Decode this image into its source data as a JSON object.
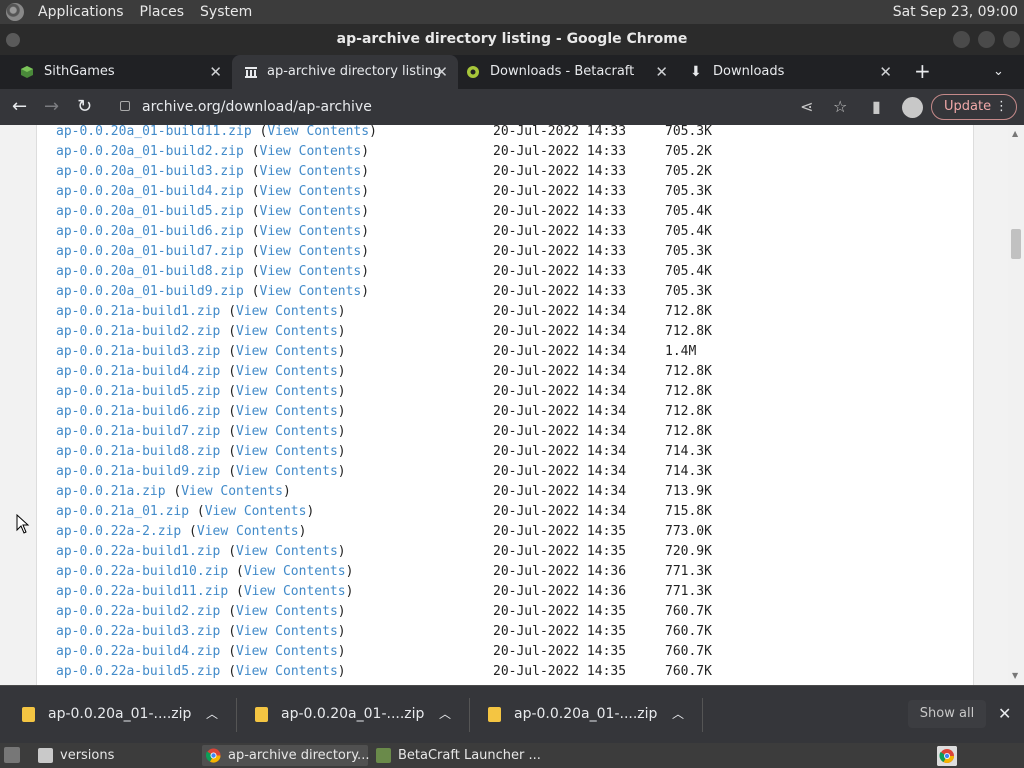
{
  "top_panel": {
    "menus": [
      "Applications",
      "Places",
      "System"
    ],
    "clock": "Sat Sep 23, 09:00"
  },
  "window": {
    "title": "ap-archive directory listing - Google Chrome"
  },
  "tabs": [
    {
      "label": "SithGames",
      "active": false
    },
    {
      "label": "ap-archive directory listing",
      "active": true
    },
    {
      "label": "Downloads - Betacraft",
      "active": false
    },
    {
      "label": "Downloads",
      "active": false
    }
  ],
  "toolbar": {
    "url": "archive.org/download/ap-archive",
    "update_label": "Update"
  },
  "listing": {
    "view_contents_label": "View Contents",
    "rows": [
      {
        "name": "ap-0.0.20a_01-build11.zip",
        "date": "20-Jul-2022 14:33",
        "size": "705.3K"
      },
      {
        "name": "ap-0.0.20a_01-build2.zip",
        "date": "20-Jul-2022 14:33",
        "size": "705.2K"
      },
      {
        "name": "ap-0.0.20a_01-build3.zip",
        "date": "20-Jul-2022 14:33",
        "size": "705.2K"
      },
      {
        "name": "ap-0.0.20a_01-build4.zip",
        "date": "20-Jul-2022 14:33",
        "size": "705.3K"
      },
      {
        "name": "ap-0.0.20a_01-build5.zip",
        "date": "20-Jul-2022 14:33",
        "size": "705.4K"
      },
      {
        "name": "ap-0.0.20a_01-build6.zip",
        "date": "20-Jul-2022 14:33",
        "size": "705.4K"
      },
      {
        "name": "ap-0.0.20a_01-build7.zip",
        "date": "20-Jul-2022 14:33",
        "size": "705.3K"
      },
      {
        "name": "ap-0.0.20a_01-build8.zip",
        "date": "20-Jul-2022 14:33",
        "size": "705.4K"
      },
      {
        "name": "ap-0.0.20a_01-build9.zip",
        "date": "20-Jul-2022 14:33",
        "size": "705.3K"
      },
      {
        "name": "ap-0.0.21a-build1.zip",
        "date": "20-Jul-2022 14:34",
        "size": "712.8K"
      },
      {
        "name": "ap-0.0.21a-build2.zip",
        "date": "20-Jul-2022 14:34",
        "size": "712.8K"
      },
      {
        "name": "ap-0.0.21a-build3.zip",
        "date": "20-Jul-2022 14:34",
        "size": "1.4M"
      },
      {
        "name": "ap-0.0.21a-build4.zip",
        "date": "20-Jul-2022 14:34",
        "size": "712.8K"
      },
      {
        "name": "ap-0.0.21a-build5.zip",
        "date": "20-Jul-2022 14:34",
        "size": "712.8K"
      },
      {
        "name": "ap-0.0.21a-build6.zip",
        "date": "20-Jul-2022 14:34",
        "size": "712.8K"
      },
      {
        "name": "ap-0.0.21a-build7.zip",
        "date": "20-Jul-2022 14:34",
        "size": "712.8K"
      },
      {
        "name": "ap-0.0.21a-build8.zip",
        "date": "20-Jul-2022 14:34",
        "size": "714.3K"
      },
      {
        "name": "ap-0.0.21a-build9.zip",
        "date": "20-Jul-2022 14:34",
        "size": "714.3K"
      },
      {
        "name": "ap-0.0.21a.zip",
        "date": "20-Jul-2022 14:34",
        "size": "713.9K"
      },
      {
        "name": "ap-0.0.21a_01.zip",
        "date": "20-Jul-2022 14:34",
        "size": "715.8K"
      },
      {
        "name": "ap-0.0.22a-2.zip",
        "date": "20-Jul-2022 14:35",
        "size": "773.0K"
      },
      {
        "name": "ap-0.0.22a-build1.zip",
        "date": "20-Jul-2022 14:35",
        "size": "720.9K"
      },
      {
        "name": "ap-0.0.22a-build10.zip",
        "date": "20-Jul-2022 14:36",
        "size": "771.3K"
      },
      {
        "name": "ap-0.0.22a-build11.zip",
        "date": "20-Jul-2022 14:36",
        "size": "771.3K"
      },
      {
        "name": "ap-0.0.22a-build2.zip",
        "date": "20-Jul-2022 14:35",
        "size": "760.7K"
      },
      {
        "name": "ap-0.0.22a-build3.zip",
        "date": "20-Jul-2022 14:35",
        "size": "760.7K"
      },
      {
        "name": "ap-0.0.22a-build4.zip",
        "date": "20-Jul-2022 14:35",
        "size": "760.7K"
      },
      {
        "name": "ap-0.0.22a-build5.zip",
        "date": "20-Jul-2022 14:35",
        "size": "760.7K"
      }
    ]
  },
  "downloads": {
    "items": [
      "ap-0.0.20a_01-....zip",
      "ap-0.0.20a_01-....zip",
      "ap-0.0.20a_01-....zip"
    ],
    "show_all_label": "Show all"
  },
  "taskbar": {
    "tasks": [
      {
        "label": "versions",
        "active": false
      },
      {
        "label": "ap-archive directory...",
        "active": true
      },
      {
        "label": "BetaCraft Launcher ...",
        "active": false
      }
    ]
  }
}
